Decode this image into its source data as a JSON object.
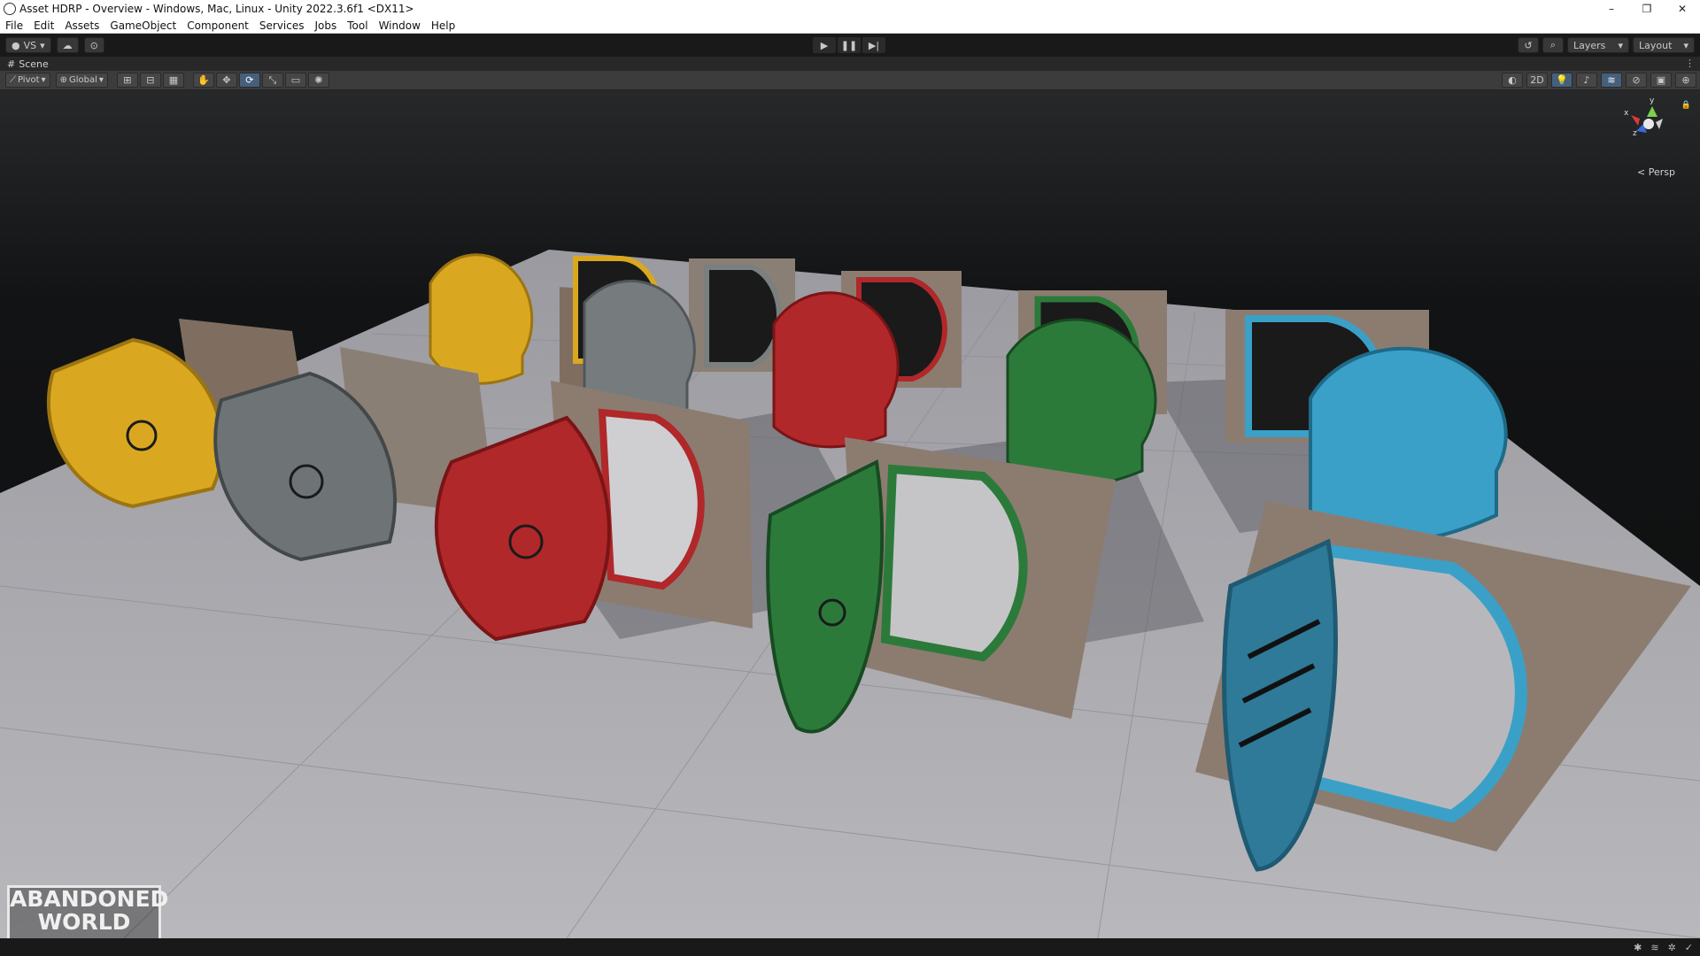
{
  "window": {
    "title": "Asset HDRP - Overview - Windows, Mac, Linux - Unity 2022.3.6f1 <DX11>",
    "controls": [
      "–",
      "❐",
      "✕"
    ]
  },
  "menu": [
    "File",
    "Edit",
    "Assets",
    "GameObject",
    "Component",
    "Services",
    "Jobs",
    "Tool",
    "Window",
    "Help"
  ],
  "toolbar": {
    "account_label": "VS",
    "layers_label": "Layers",
    "layout_label": "Layout"
  },
  "scene": {
    "tab_label": "Scene",
    "pivot_label": "Pivot",
    "global_label": "Global",
    "view_2d_label": "2D",
    "projection_label": "< Persp",
    "gizmo_axes": [
      "y",
      "x",
      "z"
    ]
  },
  "watermark": {
    "line1": "ABANDONED",
    "line2": "WORLD"
  },
  "colors": {
    "yellow": "#d9a820",
    "gray": "#7a7f80",
    "red": "#b0282a",
    "green": "#2c7a3a",
    "blue": "#3aa0c8",
    "frame": "#8f7f70",
    "floor": "#b4b4b8"
  }
}
